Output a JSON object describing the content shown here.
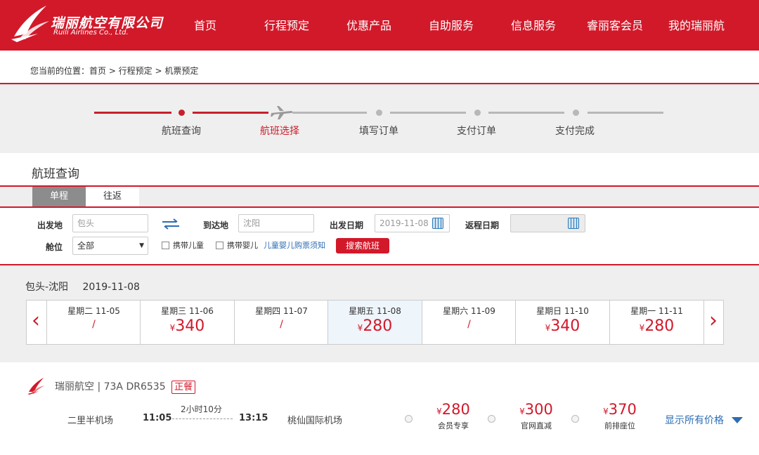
{
  "header": {
    "logo_cn": "瑞丽航空有限公司",
    "logo_en": "Ruili Airlines Co., Ltd.",
    "nav": [
      "首页",
      "行程预定",
      "优惠产品",
      "自助服务",
      "信息服务",
      "睿丽客会员",
      "我的瑞丽航"
    ],
    "brand_color": "#d2192a"
  },
  "breadcrumb": "您当前的位置：首页 > 行程预定 > 机票预定",
  "steps": {
    "items": [
      "航班查询",
      "航班选择",
      "填写订单",
      "支付订单",
      "支付完成"
    ],
    "current_index": 1
  },
  "query": {
    "title": "航班查询",
    "tabs": [
      "单程",
      "往返"
    ],
    "active_tab": 0,
    "from_label": "出发地",
    "from_value": "包头",
    "to_label": "到达地",
    "to_value": "沈阳",
    "date_label": "出发日期",
    "date_value": "2019-11-08",
    "return_label": "返程日期",
    "return_value": "",
    "cabin_label": "舱位",
    "cabin_value": "全部",
    "child_label": "携带儿童",
    "infant_label": "携带婴儿",
    "notice_link": "儿童婴儿购票须知",
    "search_button": "搜索航班"
  },
  "results": {
    "route": "包头-沈阳",
    "date": "2019-11-08",
    "prev_arrow": "‹",
    "next_arrow": "›",
    "days": [
      {
        "name": "星期二  11-05",
        "price": null
      },
      {
        "name": "星期三  11-06",
        "price": "340"
      },
      {
        "name": "星期四  11-07",
        "price": null
      },
      {
        "name": "星期五  11-08",
        "price": "280",
        "selected": true
      },
      {
        "name": "星期六  11-09",
        "price": null
      },
      {
        "name": "星期日  11-10",
        "price": "340"
      },
      {
        "name": "星期一  11-11",
        "price": "280"
      }
    ],
    "yen": "¥",
    "no_price": "/"
  },
  "flight": {
    "airline_info": "瑞丽航空 | 73A DR6535",
    "meal": "正餐",
    "dep_airport": "二里半机场",
    "dep_time": "11:05",
    "duration": "2小时10分",
    "arr_time": "13:15",
    "arr_airport": "桃仙国际机场",
    "prices": [
      {
        "amount": "280",
        "label": "会员专享"
      },
      {
        "amount": "300",
        "label": "官网直减"
      },
      {
        "amount": "370",
        "label": "前排座位"
      }
    ],
    "show_all": "显示所有价格"
  }
}
